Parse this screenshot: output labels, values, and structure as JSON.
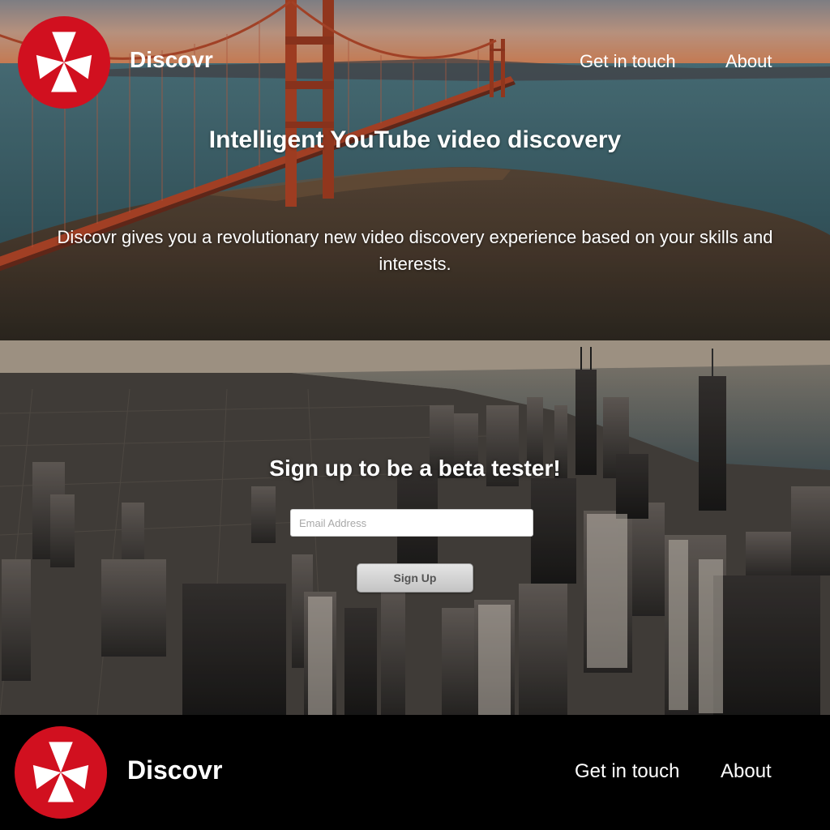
{
  "header": {
    "brand": "Discovr",
    "nav": {
      "contact": "Get in touch",
      "about": "About"
    }
  },
  "hero": {
    "title": "Intelligent YouTube video discovery",
    "description": "Discovr gives you a revolutionary new video discovery experience based on your skills and interests."
  },
  "signup": {
    "title": "Sign up to be a beta tester!",
    "email_placeholder": "Email Address",
    "email_value": "",
    "button_label": "Sign Up"
  },
  "footer": {
    "brand": "Discovr",
    "nav": {
      "contact": "Get in touch",
      "about": "About"
    }
  },
  "colors": {
    "brand_red": "#d1101f",
    "footer_bg": "#000000",
    "text": "#ffffff"
  },
  "icons": {
    "logo": "pinwheel-logo-icon"
  }
}
